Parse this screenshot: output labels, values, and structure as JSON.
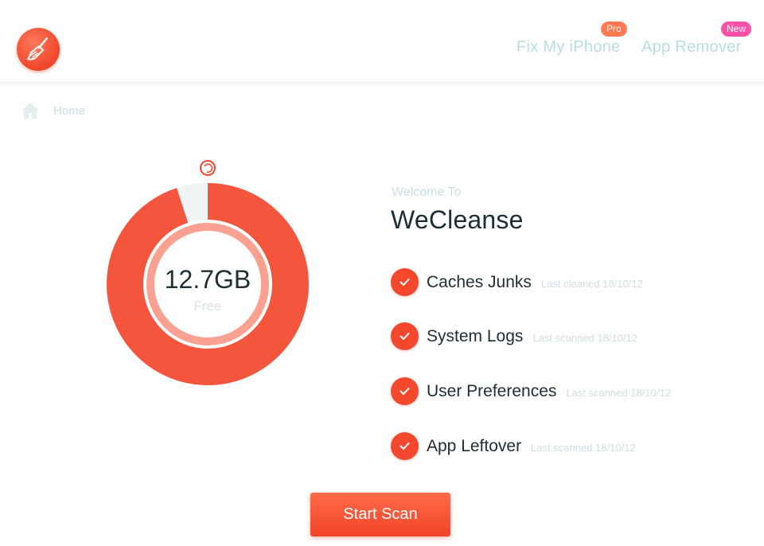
{
  "app": {
    "logo_icon": "broom-icon",
    "accent_color": "#f3482e"
  },
  "nav": {
    "fix_iphone": {
      "label": "Fix My iPhone",
      "badge": "Pro"
    },
    "app_remover": {
      "label": "App Remover",
      "badge": "New"
    }
  },
  "breadcrumb": {
    "icon": "home-icon",
    "label": "Home"
  },
  "storage": {
    "value": "12.7GB",
    "label": "Free",
    "used_fraction": 0.95
  },
  "welcome": {
    "subtitle": "Welcome To",
    "title": "WeCleanse"
  },
  "items": [
    {
      "label": "Caches Junks",
      "meta": "Last cleaned 18/10/12",
      "status": "checked"
    },
    {
      "label": "System Logs",
      "meta": "Last scanned 18/10/12",
      "status": "checked"
    },
    {
      "label": "User Preferences",
      "meta": "Last scanned 18/10/12",
      "status": "checked"
    },
    {
      "label": "App Leftover",
      "meta": "Last scanned 18/10/12",
      "status": "checked"
    }
  ],
  "actions": {
    "start_scan": "Start Scan"
  }
}
